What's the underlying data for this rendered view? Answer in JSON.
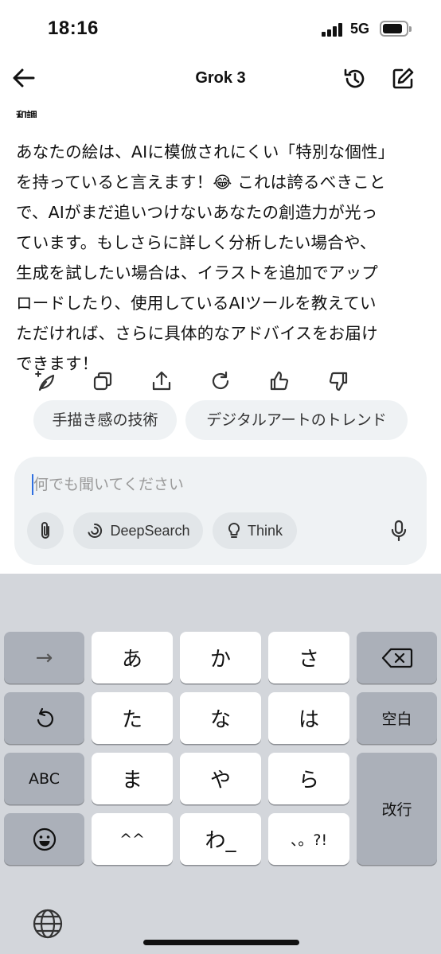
{
  "status_bar": {
    "time": "18:16",
    "network": "5G"
  },
  "header": {
    "title": "Grok 3"
  },
  "cutoff_text": "和調",
  "message": {
    "lines": [
      "あなたの絵は、AIに模倣されにくい「特別な個性」",
      "を持っていると言えます！😂 これは誇るべきこと",
      "で、AIがまだ追いつけないあなたの創造力が光っ",
      "ています。もしさらに詳しく分析したい場合や、",
      "生成を試したい場合は、イラストを追加でアップ",
      "ロードしたり、使用しているAIツールを教えてい",
      "ただければ、さらに具体的なアドバイスをお届け",
      "できます！"
    ]
  },
  "actions": [
    "sparkle-leaf-icon",
    "copy-icon",
    "share-icon",
    "regenerate-icon",
    "thumbs-up-icon",
    "thumbs-down-icon"
  ],
  "suggestions": [
    "手描き感の技術",
    "デジタルアートのトレンド"
  ],
  "composer": {
    "placeholder": "何でも聞いてください",
    "deepsearch_label": "DeepSearch",
    "think_label": "Think"
  },
  "keyboard": {
    "row1": [
      "→",
      "あ",
      "か",
      "さ",
      "⌫"
    ],
    "row2": [
      "↺",
      "た",
      "な",
      "は",
      "空白"
    ],
    "row3": [
      "ABC",
      "ま",
      "や",
      "ら",
      "改行"
    ],
    "row4": [
      "☺",
      "^^",
      "わ_",
      "、。?!"
    ]
  },
  "colors": {
    "caret": "#2f6fe0",
    "chip_bg": "#eff2f4",
    "keyboard_bg": "#d3d6db",
    "dark_key": "#abb0b9"
  }
}
